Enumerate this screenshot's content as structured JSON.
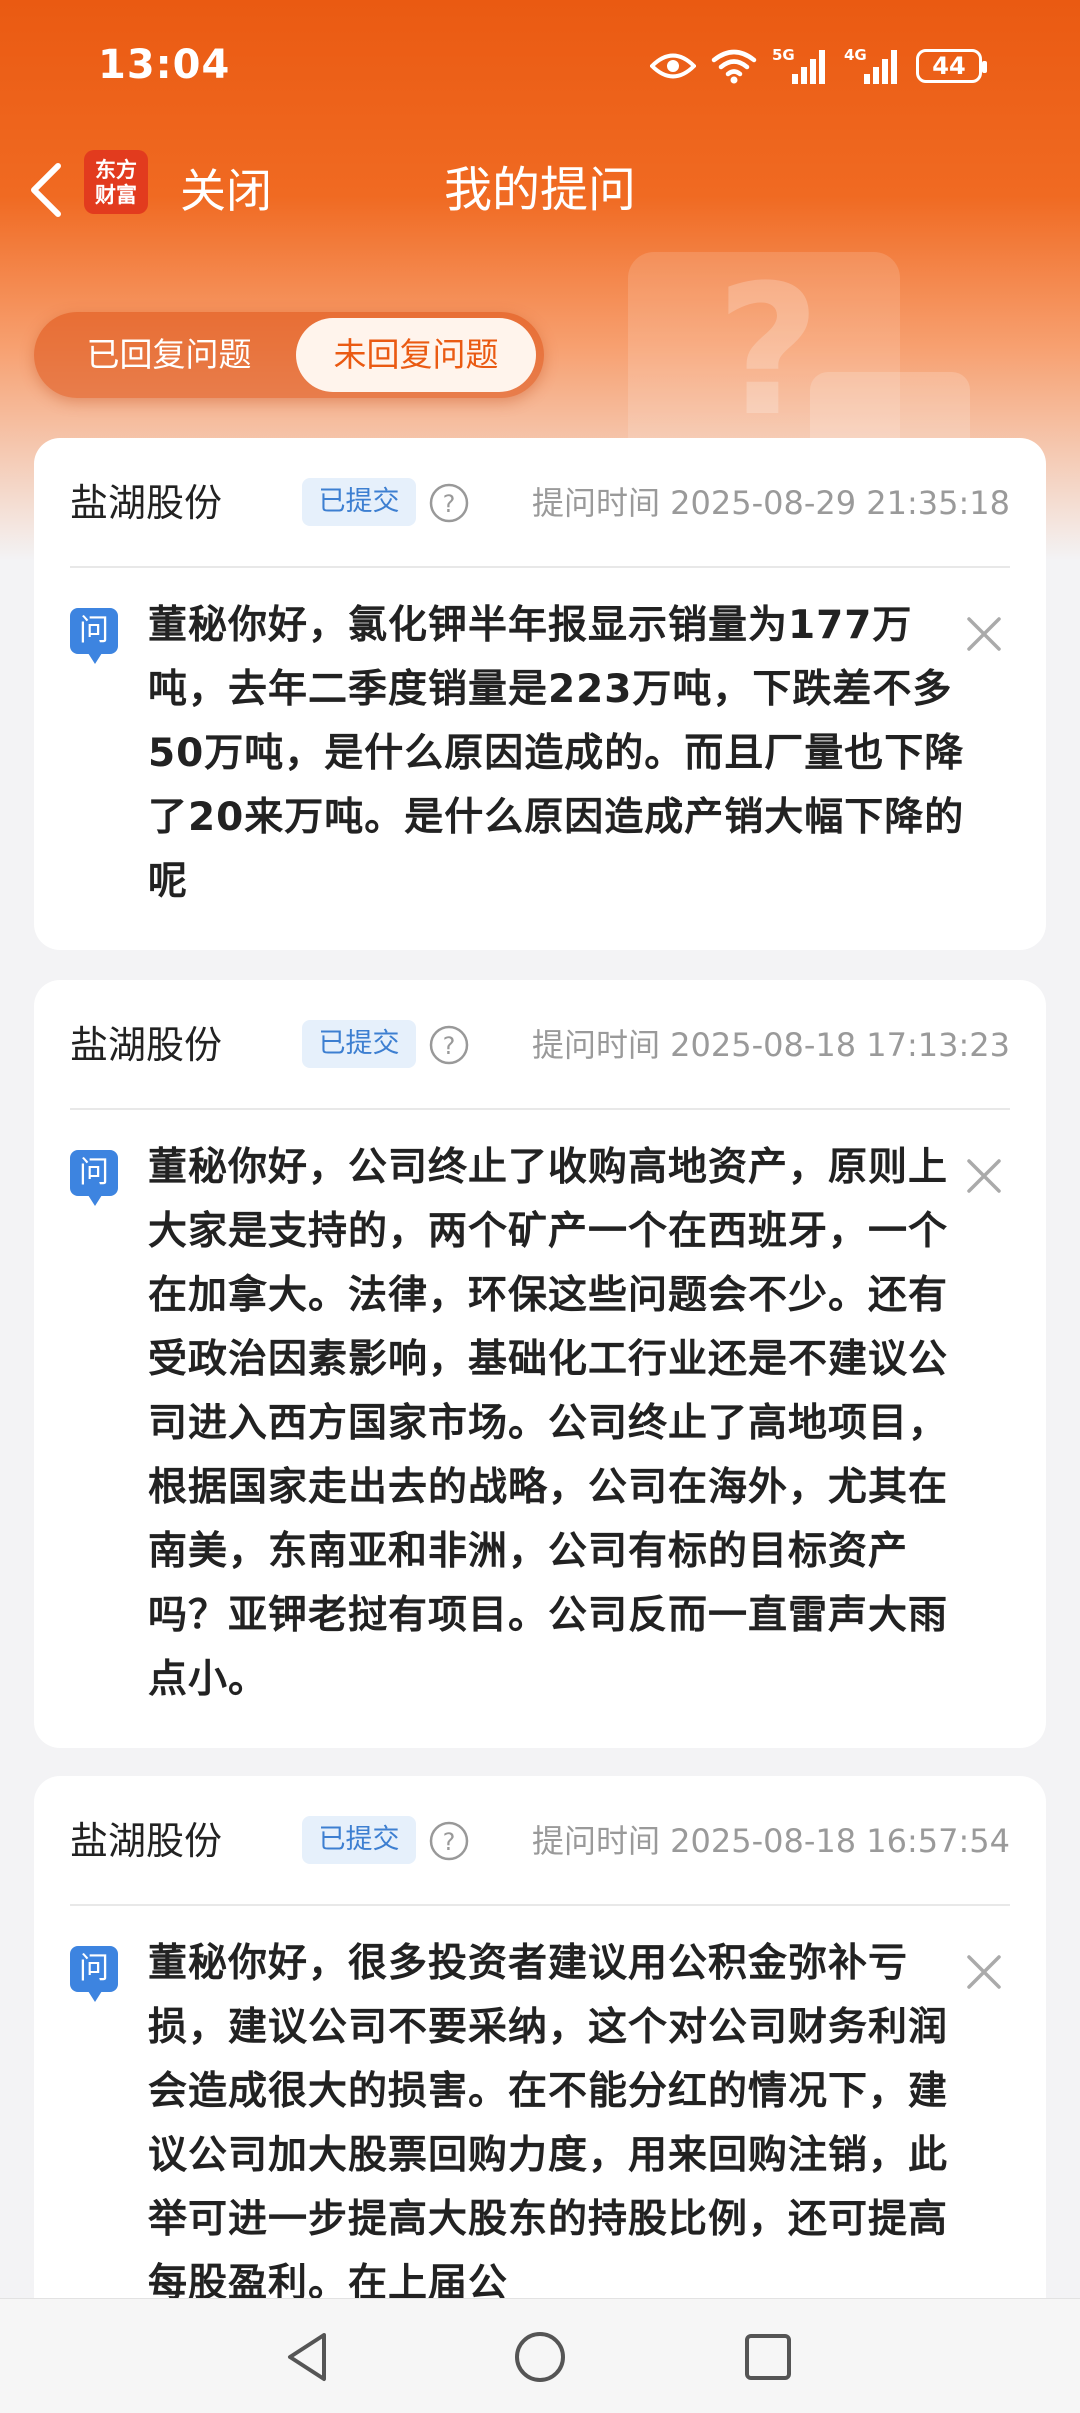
{
  "status_bar": {
    "time": "13:04",
    "icons": [
      "eye-icon",
      "wifi-icon",
      "5g-signal-icon",
      "4g-signal-icon"
    ],
    "network_5g": "5G",
    "network_4g": "4G",
    "battery": "44"
  },
  "nav": {
    "logo_line1": "东方",
    "logo_line2": "财富",
    "close_label": "关闭",
    "title": "我的提问"
  },
  "tabs": [
    {
      "label": "已回复问题",
      "selected": false
    },
    {
      "label": "未回复问题",
      "selected": true
    }
  ],
  "questions": [
    {
      "company": "盐湖股份",
      "status": "已提交",
      "time": "提问时间 2025-08-29 21:35:18",
      "q_label": "问",
      "text": "董秘你好，氯化钾半年报显示销量为177万吨，去年二季度销量是223万吨，下跌差不多50万吨，是什么原因造成的。而且厂量也下降了20来万吨。是什么原因造成产销大幅下降的呢"
    },
    {
      "company": "盐湖股份",
      "status": "已提交",
      "time": "提问时间 2025-08-18 17:13:23",
      "q_label": "问",
      "text": "董秘你好，公司终止了收购高地资产，原则上大家是支持的，两个矿产一个在西班牙，一个在加拿大。法律，环保这些问题会不少。还有受政治因素影响，基础化工行业还是不建议公司进入西方国家市场。公司终止了高地项目，根据国家走出去的战略，公司在海外，尤其在南美，东南亚和非洲，公司有标的目标资产吗？亚钾老挝有项目。公司反而一直雷声大雨点小。"
    },
    {
      "company": "盐湖股份",
      "status": "已提交",
      "time": "提问时间 2025-08-18 16:57:54",
      "q_label": "问",
      "text": "董秘你好，很多投资者建议用公积金弥补亏损，建议公司不要采纳，这个对公司财务利润会造成很大的损害。在不能分红的情况下，建议公司加大股票回购力度，用来回购注销，此举可进一步提高大股东的持股比例，还可提高每股盈利。在上届公"
    }
  ],
  "colors": {
    "brand_orange": "#ea5a12",
    "badge_blue": "#3d7fd1",
    "question_icon_blue": "#3d84e0"
  },
  "bottom_nav": [
    "back-triangle-icon",
    "home-circle-icon",
    "recents-square-icon"
  ]
}
